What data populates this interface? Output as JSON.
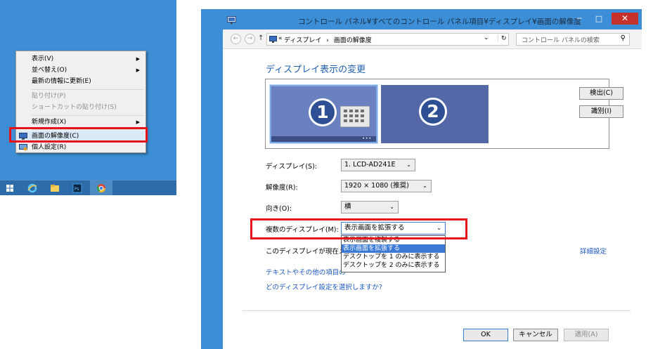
{
  "context_menu": {
    "items": [
      {
        "label": "表示(V)",
        "submenu": true,
        "disabled": false
      },
      {
        "label": "並べ替え(O)",
        "submenu": true,
        "disabled": false
      },
      {
        "label": "最新の情報に更新(E)",
        "submenu": false,
        "disabled": false
      },
      {
        "label": "貼り付け(P)",
        "submenu": false,
        "disabled": true
      },
      {
        "label": "ショートカットの貼り付け(S)",
        "submenu": false,
        "disabled": true
      },
      {
        "label": "新規作成(X)",
        "submenu": true,
        "disabled": false
      },
      {
        "label": "画面の解像度(C)",
        "submenu": false,
        "disabled": false
      },
      {
        "label": "個人設定(R)",
        "submenu": false,
        "disabled": false
      }
    ]
  },
  "taskbar": {
    "icons": [
      "windows-start-icon",
      "internet-explorer-icon",
      "file-explorer-icon",
      "photoshop-icon",
      "chrome-icon"
    ]
  },
  "window": {
    "title": "コントロール パネル¥すべてのコントロール パネル項目¥ディスプレイ¥画面の解像度",
    "minimize": "─",
    "maximize": "□",
    "close": "✕"
  },
  "address": {
    "back": "←",
    "forward": "→",
    "up": "↑",
    "path_prefix": "«",
    "crumb1": "ディスプレイ",
    "crumb_sep": "›",
    "crumb2": "画面の解像度",
    "dropdown": "⌄",
    "refresh": "↻",
    "search_placeholder": "コントロール パネルの検索",
    "search_icon": "⚲"
  },
  "heading": "ディスプレイ表示の変更",
  "monitors": {
    "m1": "1",
    "m2": "2",
    "detect": "検出(C)",
    "identify": "識別(I)"
  },
  "form": {
    "display_label": "ディスプレイ(S):",
    "display_value": "1. LCD-AD241E",
    "resolution_label": "解像度(R):",
    "resolution_value": "1920 × 1080 (推奨)",
    "orientation_label": "向き(O):",
    "orientation_value": "横",
    "multi_label": "複数のディスプレイ(M):",
    "multi_value": "表示画面を拡張する",
    "multi_options": [
      "表示画面を複製する",
      "表示画面を拡張する",
      "デスクトップを 1 のみに表示する",
      "デスクトップを 2 のみに表示する"
    ],
    "current_display_text": "このディスプレイが現在メイ",
    "advanced_link": "詳細設定"
  },
  "links": {
    "text_size": "テキストやその他の項目の",
    "which_settings": "どのディスプレイ設定を選択しますか?"
  },
  "buttons": {
    "ok": "OK",
    "cancel": "キャンセル",
    "apply": "適用(A)"
  },
  "colors": {
    "accent": "#3c8fd6",
    "link": "#1d58c4",
    "highlight_box": "#e8141b",
    "monitor_face": "#5b6fb0"
  }
}
